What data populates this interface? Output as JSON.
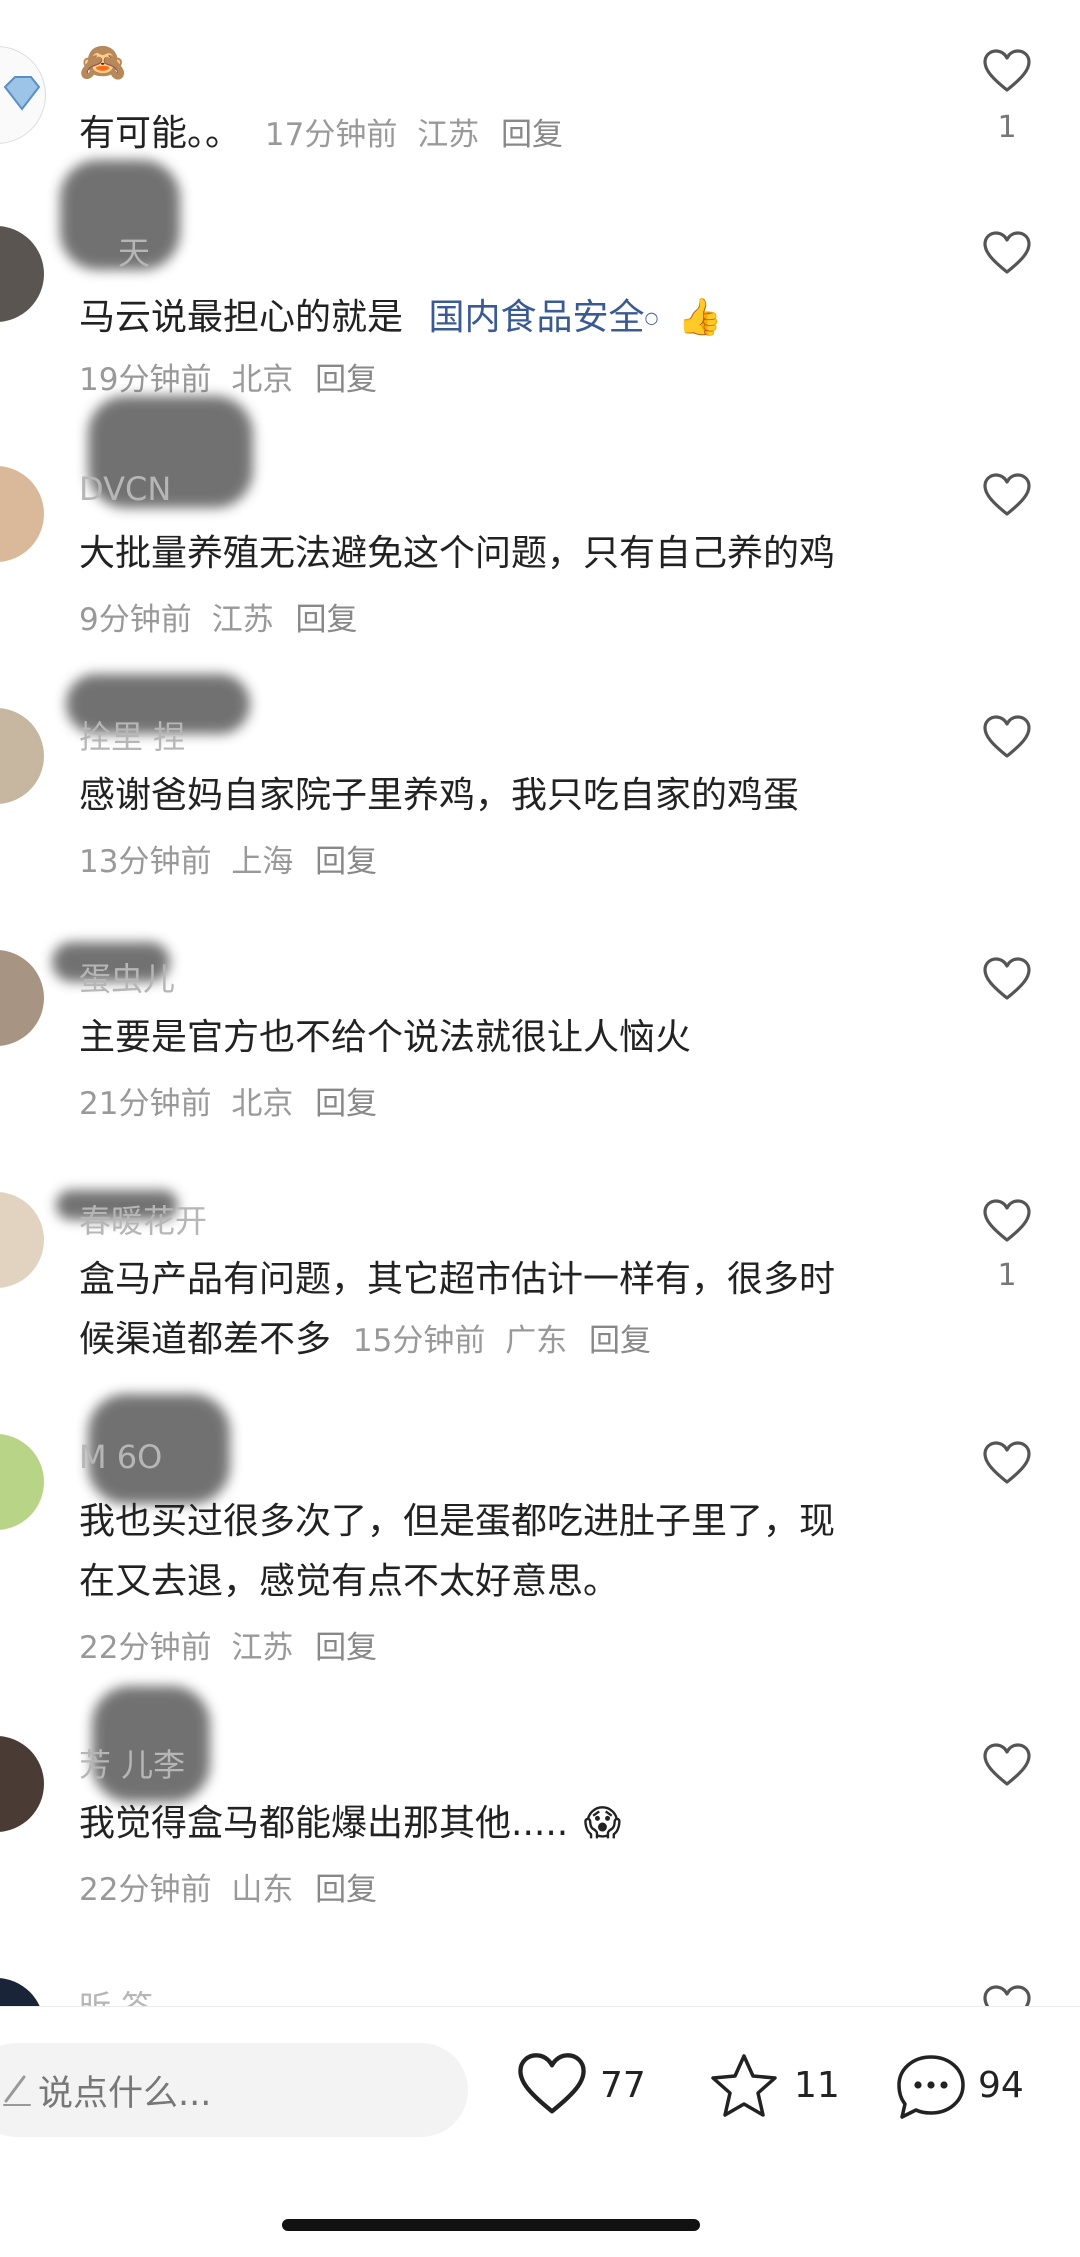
{
  "comments": [
    {
      "emoji": "🙈",
      "text": "有可能。。",
      "time": "17分钟前",
      "location": "江苏",
      "reply": "回复",
      "likes": "1"
    },
    {
      "name": "天",
      "text": "马云说最担心的就是",
      "link": "国内食品安全",
      "emoji": "👍",
      "time": "19分钟前",
      "location": "北京",
      "reply": "回复"
    },
    {
      "name": "DVCN",
      "text": "大批量养殖无法避免这个问题，只有自己养的鸡",
      "time": "9分钟前",
      "location": "江苏",
      "reply": "回复"
    },
    {
      "name": "拴里  捏",
      "text": "感谢爸妈自家院子里养鸡，我只吃自家的鸡蛋",
      "time": "13分钟前",
      "location": "上海",
      "reply": "回复"
    },
    {
      "name": "蛋虫儿",
      "text": "主要是官方也不给个说法就很让人恼火",
      "time": "21分钟前",
      "location": "北京",
      "reply": "回复"
    },
    {
      "name": "春暖花开",
      "text_line1": "盒马产品有问题，其它超市估计一样有，很多时",
      "text_line2": "候渠道都差不多",
      "time": "15分钟前",
      "location": "广东",
      "reply": "回复",
      "likes": "1"
    },
    {
      "name": "M   6O",
      "text_line1": "我也买过很多次了，但是蛋都吃进肚子里了，现",
      "text_line2": "在又去退，感觉有点不太好意思。",
      "time": "22分钟前",
      "location": "江苏",
      "reply": "回复"
    },
    {
      "name": "芳   儿李",
      "text": "我觉得盒马都能爆出那其他.....",
      "emoji": "😱",
      "time": "22分钟前",
      "location": "山东",
      "reply": "回复"
    },
    {
      "name": "昕     答"
    }
  ],
  "bottom_bar": {
    "input_placeholder": "说点什么...",
    "like_count": "77",
    "star_count": "11",
    "comment_count": "94"
  },
  "colors": {
    "link": "#3a5a94",
    "meta": "#999999",
    "text": "#222222"
  }
}
